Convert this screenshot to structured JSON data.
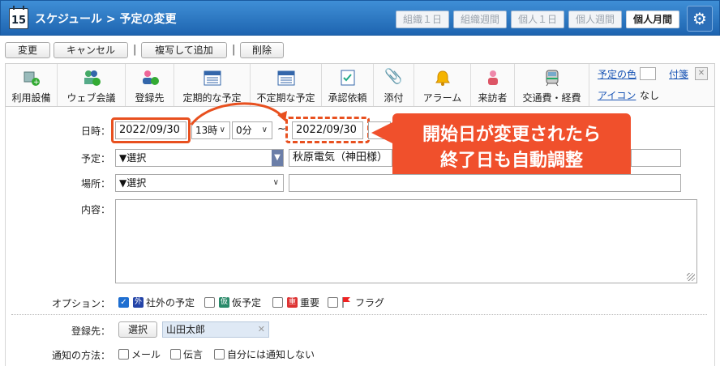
{
  "header": {
    "calendar_day": "15",
    "title": "スケジュール > 予定の変更",
    "views": [
      "組織１日",
      "組織週間",
      "個人１日",
      "個人週間",
      "個人月間"
    ],
    "active_view": "個人月間"
  },
  "actions": {
    "change": "変更",
    "cancel": "キャンセル",
    "copy_add": "複写して追加",
    "delete": "削除",
    "separator": "|"
  },
  "toolbar": {
    "items": [
      {
        "label": "利用設備",
        "icon": "facility-add-icon"
      },
      {
        "label": "ウェブ会議",
        "icon": "web-meeting-icon"
      },
      {
        "label": "登録先",
        "icon": "user-add-icon"
      },
      {
        "label": "定期的な予定",
        "icon": "calendar-icon"
      },
      {
        "label": "不定期な予定",
        "icon": "calendar-icon"
      },
      {
        "label": "承認依頼",
        "icon": "approval-icon"
      },
      {
        "label": "添付",
        "icon": "paperclip-icon"
      },
      {
        "label": "アラーム",
        "icon": "bell-icon"
      },
      {
        "label": "来訪者",
        "icon": "visitor-icon"
      },
      {
        "label": "交通費・経費",
        "icon": "train-icon"
      }
    ],
    "color_label": "予定の色",
    "sticky_label": "付箋",
    "icon_label": "アイコン",
    "icon_value": "なし"
  },
  "form": {
    "datetime_label": "日時：",
    "start_date": "2022/09/30",
    "start_hour": "13時",
    "start_min": "0分",
    "tilde": "~",
    "end_date": "2022/09/30",
    "subject_label": "予定：",
    "subject_select": "▼選択",
    "subject_value": "秋原電気（神田様）",
    "place_label": "場所：",
    "place_select": "▼選択",
    "content_label": "内容：",
    "options_label": "オプション：",
    "options": [
      {
        "label": "社外の予定",
        "badge": "外",
        "checked": true
      },
      {
        "label": "仮予定",
        "badge": "仮",
        "checked": false
      },
      {
        "label": "重要",
        "badge": "重",
        "checked": false
      },
      {
        "label": "フラグ",
        "badge": "",
        "checked": false
      }
    ],
    "registrant_label": "登録先：",
    "select_button": "選択",
    "registrant_user": "山田太郎",
    "notify_label": "通知の方法：",
    "notify_options": [
      "メール",
      "伝言",
      "自分には通知しない"
    ]
  },
  "callout": {
    "line1": "開始日が変更されたら",
    "line2": "終了日も自動調整"
  },
  "colors": {
    "header_blue": "#1e64b0",
    "accent_orange": "#e8501f",
    "callout_bg": "#f0502c"
  }
}
